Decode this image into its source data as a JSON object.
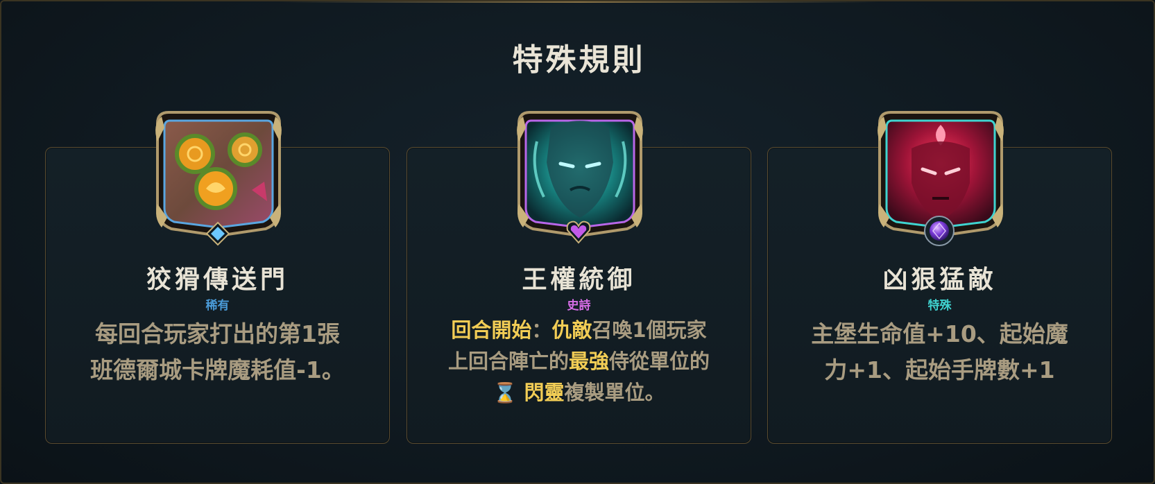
{
  "title": "特殊規則",
  "cards": [
    {
      "name": "狡猾傳送門",
      "rarity": "稀有",
      "rarity_color": "#4a9bd8",
      "icon": "portal-seeds-art-icon",
      "gem": "diamond-gem-icon",
      "description_lines": [
        "每回合玩家打出的第1張",
        "班德爾城卡牌魔耗值-1。"
      ]
    },
    {
      "name": "王權統御",
      "rarity": "史詩",
      "rarity_color": "#d86ee8",
      "icon": "spectral-king-art-icon",
      "gem": "heart-gem-icon",
      "description": {
        "kw1": "回合開始",
        "colon": "：",
        "kw2": "仇敵",
        "t1": "召喚1個玩家",
        "t2": "上回合陣亡的",
        "kw3": "最強",
        "t3": "侍從單位的",
        "kw4": "閃靈",
        "t4": "複製單位。"
      }
    },
    {
      "name": "凶狠猛敵",
      "rarity": "特殊",
      "rarity_color": "#3fd3d0",
      "icon": "crimson-demon-art-icon",
      "gem": "orb-gem-icon",
      "description_lines": [
        "主堡生命值+10、起始魔",
        "力+1、起始手牌數+1"
      ]
    }
  ]
}
